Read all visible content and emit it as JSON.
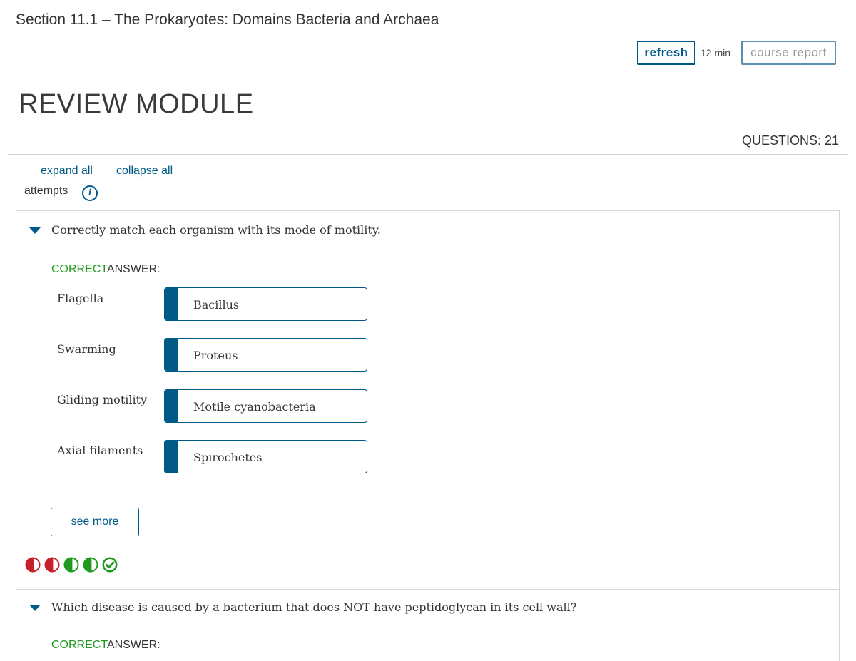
{
  "header": {
    "section_title": "Section 11.1 – The Prokaryotes: Domains Bacteria and Archaea",
    "refresh_label": "refresh",
    "time_label": "12 min",
    "course_report_label": "course report"
  },
  "module": {
    "title": "REVIEW MODULE",
    "questions_count": "QUESTIONS: 21"
  },
  "controls": {
    "expand_all": "expand all",
    "collapse_all": "collapse all",
    "attempts_label": "attempts",
    "info_glyph": "i"
  },
  "questions": [
    {
      "text": "Correctly match each organism with its mode of motility.",
      "correct_word": "CORRECT",
      "answer_word": "ANSWER:",
      "matches": [
        {
          "label": "Flagella",
          "value": "Bacillus"
        },
        {
          "label": "Swarming",
          "value": "Proteus"
        },
        {
          "label": "Gliding motility",
          "value": "Motile cyanobacteria"
        },
        {
          "label": "Axial filaments",
          "value": "Spirochetes"
        }
      ],
      "see_more_label": "see more",
      "attempts": [
        "incorrect-half-icon",
        "incorrect-half-icon",
        "correct-half-icon",
        "correct-half-icon",
        "correct-check-icon"
      ]
    },
    {
      "text": "Which disease is caused by a bacterium that does NOT have peptidoglycan in its cell wall?",
      "correct_word": "CORRECT",
      "answer_word": "ANSWER:"
    }
  ],
  "colors": {
    "brand_blue": "#005a87",
    "correct_green": "#1f9a1f",
    "incorrect_red": "#c8202a"
  }
}
